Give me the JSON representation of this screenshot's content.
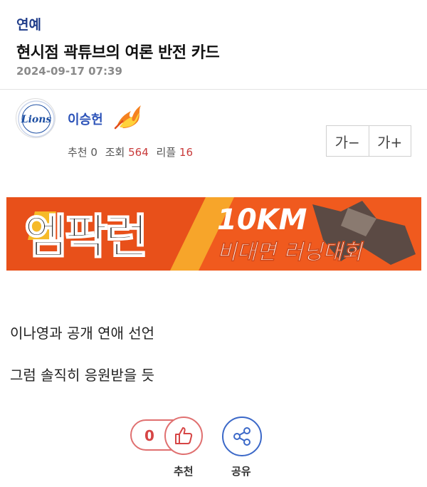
{
  "article": {
    "category": "연예",
    "title": "현시점 곽튜브의 여론 반전 카드",
    "date": "2024-09-17 07:39"
  },
  "author": {
    "name": "이승헌",
    "avatar_logo_text": "Lions",
    "badge_icon": "flame-icon"
  },
  "stats": {
    "recommend_label": "추천",
    "recommend_value": "0",
    "views_label": "조회",
    "views_value": "564",
    "replies_label": "리플",
    "replies_value": "16"
  },
  "font_controls": {
    "decrease": "가−",
    "increase": "가+"
  },
  "banner": {
    "text_main": "엠팍런",
    "text_distance": "10KM",
    "text_sub": "비대면 러닝대회",
    "bg_color": "#f05a1e"
  },
  "body": {
    "line1": "이나영과 공개 연애 선언",
    "line2": "그럼 솔직히 응원받을 듯"
  },
  "actions": {
    "like_count": "0",
    "like_label": "추천",
    "share_label": "공유",
    "like_color": "#e07070",
    "share_color": "#3b68c8"
  }
}
